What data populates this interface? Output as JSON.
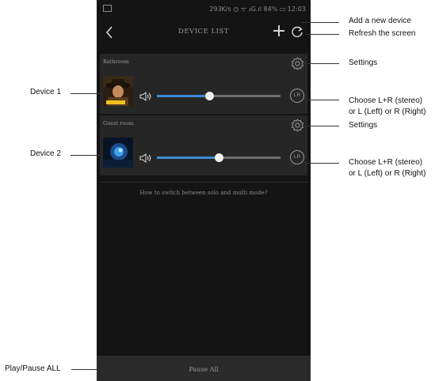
{
  "status_bar": {
    "right_text": "293K/s ◷ ᯤ ₄G.ıl 84% ▭ 12:03"
  },
  "header": {
    "title": "DEVICE LIST"
  },
  "devices": [
    {
      "name": "Bathroom",
      "volume": 0.42,
      "channel_label": "LR"
    },
    {
      "name": "Guest room",
      "volume": 0.5,
      "channel_label": "LR"
    }
  ],
  "help_link": "How to switch between solo and multi mode?",
  "footer": {
    "pause_all": "Pause All"
  },
  "annotations": {
    "add_device": "Add a new device",
    "refresh": "Refresh the screen",
    "settings_1": "Settings",
    "settings_2": "Settings",
    "device_1": "Device 1",
    "device_2": "Device 2",
    "channel_1_line1": "Choose L+R (stereo)",
    "channel_1_line2": "or L (Left) or R (Right)",
    "channel_2_line1": "Choose L+R (stereo)",
    "channel_2_line2": "or L (Left) or R (Right)",
    "play_pause_all": "Play/Pause ALL"
  },
  "colors": {
    "accent": "#3d8ad8",
    "background": "#141414",
    "card": "#262626"
  },
  "icons": [
    "back-icon",
    "add-icon",
    "refresh-icon",
    "gear-icon",
    "speaker-icon",
    "lr-channel-icon"
  ]
}
